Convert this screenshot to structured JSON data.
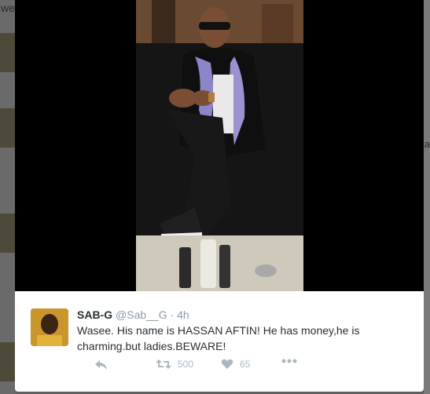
{
  "background": {
    "top_text": "we",
    "right_text": "a"
  },
  "tweet": {
    "author_name": "SAB-G",
    "author_handle": "@Sab__G",
    "separator": "·",
    "time": "4h",
    "text": "Wasee. His name is HASSAN AFTIN! He has money,he is charming.but ladies.BEWARE!",
    "retweet_count": "500",
    "like_count": "65"
  },
  "icons": {
    "reply": "reply-icon",
    "retweet": "retweet-icon",
    "like": "heart-icon",
    "more": "more-icon"
  },
  "colors": {
    "action_gray": "#aab8c2",
    "text_dark": "#292f33",
    "handle_gray": "#8899a6",
    "backdrop": "#5f5f5f"
  }
}
